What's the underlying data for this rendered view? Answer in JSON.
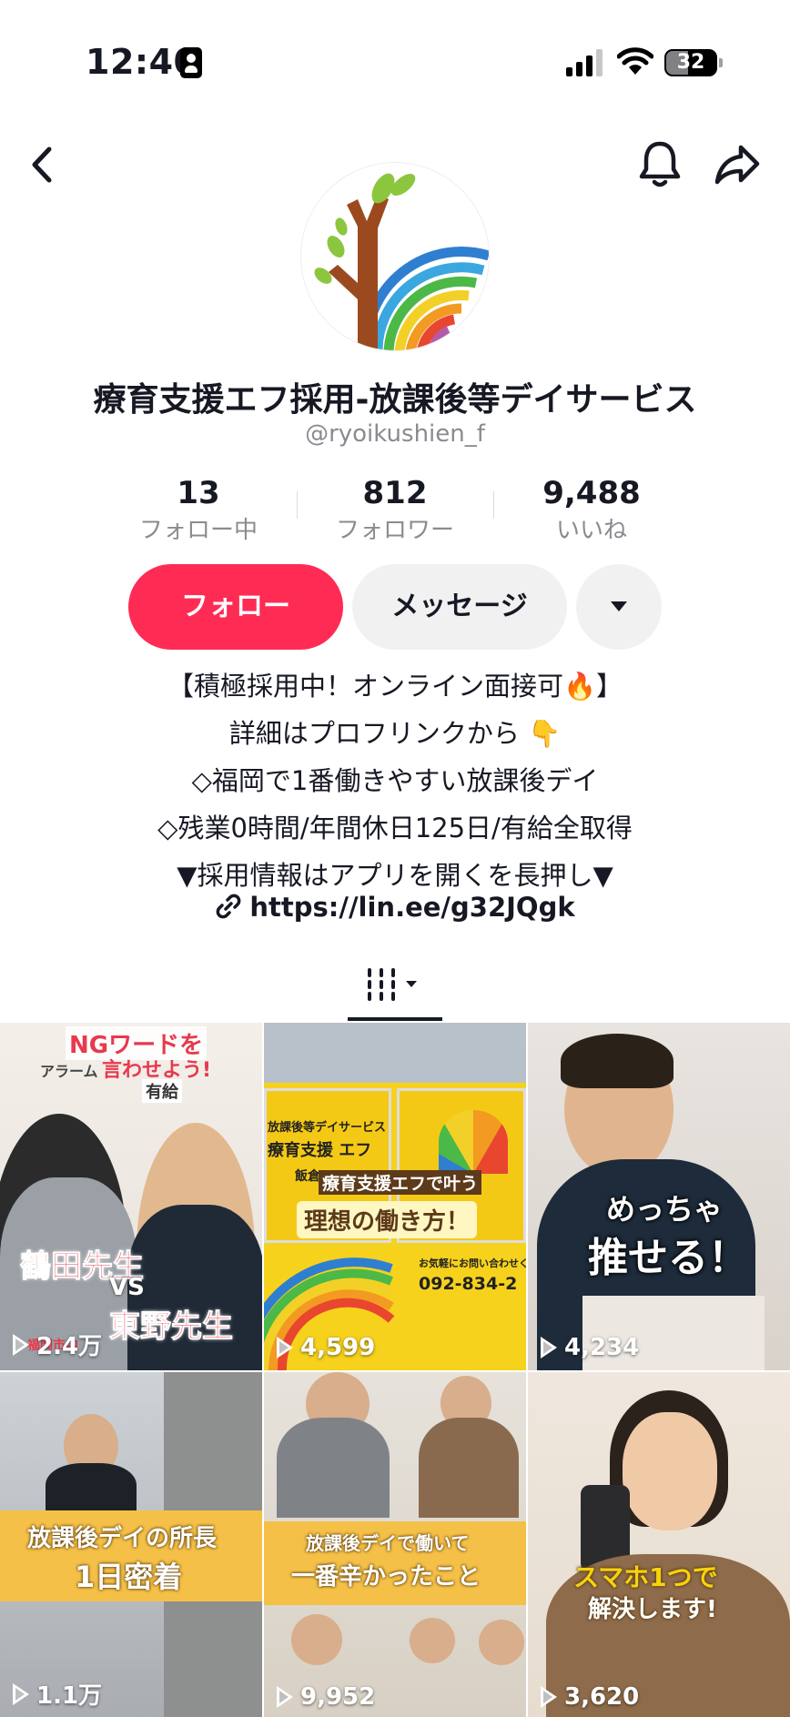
{
  "status_bar": {
    "time": "12:40",
    "battery": "32"
  },
  "profile": {
    "name": "療育支援エフ採用-放課後等デイサービス",
    "handle": "@ryoikushien_f",
    "stats": [
      {
        "value": "13",
        "label": "フォロー中"
      },
      {
        "value": "812",
        "label": "フォロワー"
      },
      {
        "value": "9,488",
        "label": "いいね"
      }
    ],
    "follow_label": "フォロー",
    "message_label": "メッセージ",
    "bio": [
      "【積極採用中！オンライン面接可🔥】",
      "詳細はプロフリンクから 👇",
      "◇福岡で1番働きやすい放課後デイ",
      "◇残業0時間/年間休日125日/有給全取得",
      "▼採用情報はアプリを開くを長押し▼"
    ],
    "link": "https://lin.ee/g32JQgk"
  },
  "colors": {
    "accent": "#fe2c55",
    "button_gray": "#f1f1f2",
    "text": "#161823",
    "muted": "#8a8b91"
  },
  "videos": [
    {
      "views": "2.4万",
      "captions": [
        "NGワードを",
        "言わせよう!",
        "鶴田先生",
        "VS",
        "東野先生"
      ],
      "extra": [
        "アラーム",
        "有給",
        "福岡市内"
      ]
    },
    {
      "views": "4,599",
      "captions": [
        "放課後等デイサービス",
        "療育支援 エフ",
        "療育支援エフで叶う",
        "理想の働き方！",
        "お気軽にお問い合わせください",
        "092-834-2"
      ],
      "extra": [
        "飯倉"
      ]
    },
    {
      "views": "4,234",
      "captions": [
        "めっちゃ",
        "推せる！"
      ]
    },
    {
      "views": "1.1万",
      "captions": [
        "放課後デイの所長",
        "1日密着"
      ]
    },
    {
      "views": "9,952",
      "captions": [
        "放課後デイで働いて",
        "一番辛かったこと"
      ]
    },
    {
      "views": "3,620",
      "captions": [
        "スマホ1つで",
        "解決します!"
      ]
    }
  ]
}
